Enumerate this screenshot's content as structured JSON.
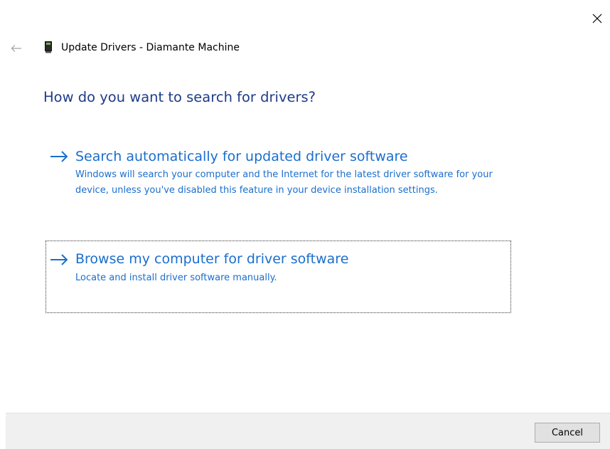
{
  "window": {
    "title": "Update Drivers - Diamante Machine",
    "close_icon": "close-icon",
    "back_icon": "back-arrow-icon",
    "device_icon": "device-icon"
  },
  "main": {
    "heading": "How do you want to search for drivers?",
    "options": [
      {
        "icon": "arrow-right-icon",
        "title": "Search automatically for updated driver software",
        "description": "Windows will search your computer and the Internet for the latest driver software for your device, unless you've disabled this feature in your device installation settings."
      },
      {
        "icon": "arrow-right-icon",
        "title": "Browse my computer for driver software",
        "description": "Locate and install driver software manually."
      }
    ]
  },
  "footer": {
    "cancel_label": "Cancel"
  },
  "colors": {
    "heading": "#1f3c88",
    "link": "#1a6ecd",
    "footer_bg": "#f0f0f0"
  }
}
